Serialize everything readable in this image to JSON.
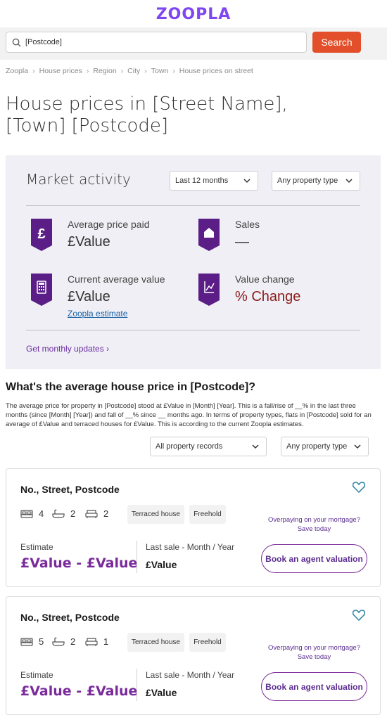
{
  "header": {
    "logo": "ZOOPLA"
  },
  "search": {
    "value": "[Postcode]",
    "button": "Search"
  },
  "breadcrumb": [
    "Zoopla",
    "House prices",
    "Region",
    "City",
    "Town",
    "House prices on street"
  ],
  "page_title": "House prices in [Street Name], [Town] [Postcode]",
  "market": {
    "title": "Market activity",
    "period": "Last 12 months",
    "property_type": "Any property type",
    "avg_price_label": "Average price paid",
    "avg_price_value": "£Value",
    "sales_label": "Sales",
    "sales_value": "—",
    "current_value_label": "Current average value",
    "current_value_value": "£Value",
    "estimate_link": "Zoopla estimate",
    "change_label": "Value change",
    "change_value": "% Change",
    "monthly_link": "Get monthly updates ›"
  },
  "average": {
    "heading": "What's the average house price in [Postcode]?",
    "text": "The average price for property in [Postcode] stood at £Value in [Month] [Year]. This is a fall/rise of __% in the last three months (since [Month] [Year]) and fall of __% since __ months ago. In terms of property types, flats in [Postcode] sold for an average of £Value and terraced houses for £Value. This is according to the current Zoopla estimates.",
    "records_filter": "All property records",
    "type_filter": "Any property type"
  },
  "properties": [
    {
      "address": "No., Street, Postcode",
      "beds": "4",
      "baths": "2",
      "receptions": "2",
      "type_tag": "Terraced house",
      "tenure_tag": "Freehold",
      "promo": "Overpaying on your mortgage? Save today",
      "estimate_label": "Estimate",
      "estimate_value": "£Value - £Value",
      "sale_label": "Last sale - Month / Year",
      "sale_value": "£Value",
      "button": "Book an agent valuation"
    },
    {
      "address": "No., Street, Postcode",
      "beds": "5",
      "baths": "2",
      "receptions": "1",
      "type_tag": "Terraced house",
      "tenure_tag": "Freehold",
      "promo": "Overpaying on your mortgage? Save today",
      "estimate_label": "Estimate",
      "estimate_value": "£Value - £Value",
      "sale_label": "Last sale - Month / Year",
      "sale_value": "£Value",
      "button": "Book an agent valuation"
    }
  ],
  "colors": {
    "brand": "#8046f1",
    "search_button": "#e24f2a",
    "accent": "#7a2a9b",
    "change": "#8b1c1c"
  },
  "icons": [
    "search-icon",
    "chevron-down-icon",
    "pound-icon",
    "house-icon",
    "calculator-icon",
    "chart-icon",
    "heart-icon",
    "bed-icon",
    "bath-icon",
    "sofa-icon"
  ]
}
